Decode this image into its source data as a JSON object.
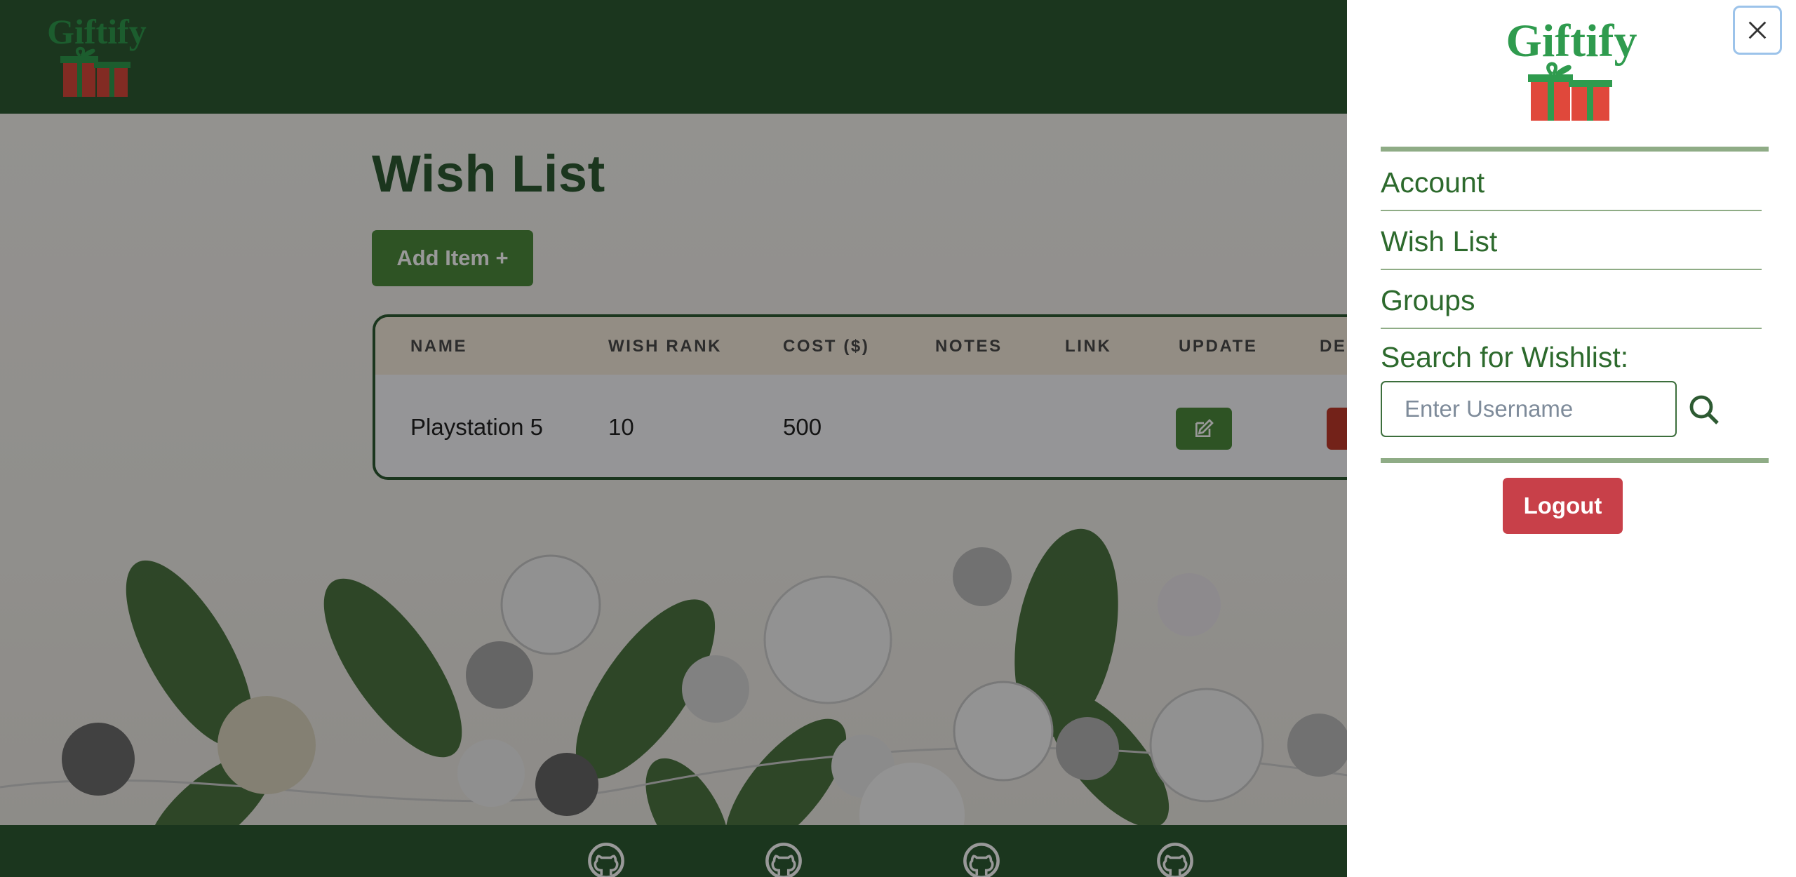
{
  "brand": {
    "name": "Giftify"
  },
  "colors": {
    "header_green": "#2d5a32",
    "button_green": "#4e8a3c",
    "danger_red": "#c0392b",
    "logout_red": "#c84049",
    "nav_text": "#2d6a2d",
    "table_header_bg": "#f5ecdc"
  },
  "page": {
    "title": "Wish List",
    "add_button": "Add Item +",
    "table": {
      "headers": [
        "NAME",
        "WISH RANK",
        "COST ($)",
        "NOTES",
        "LINK",
        "UPDATE",
        "DELETE"
      ],
      "rows": [
        {
          "name": "Playstation 5",
          "rank": "10",
          "cost": "500",
          "notes": "",
          "link": ""
        }
      ],
      "update_icon": "pencil-square-icon",
      "delete_icon": "trash-icon"
    }
  },
  "footer": {
    "icons": [
      "github-icon",
      "github-icon",
      "github-icon",
      "github-icon"
    ]
  },
  "drawer": {
    "close_icon": "close-icon",
    "nav": [
      "Account",
      "Wish List",
      "Groups"
    ],
    "search": {
      "label": "Search for Wishlist:",
      "placeholder": "Enter Username",
      "icon": "search-icon"
    },
    "logout": "Logout"
  }
}
